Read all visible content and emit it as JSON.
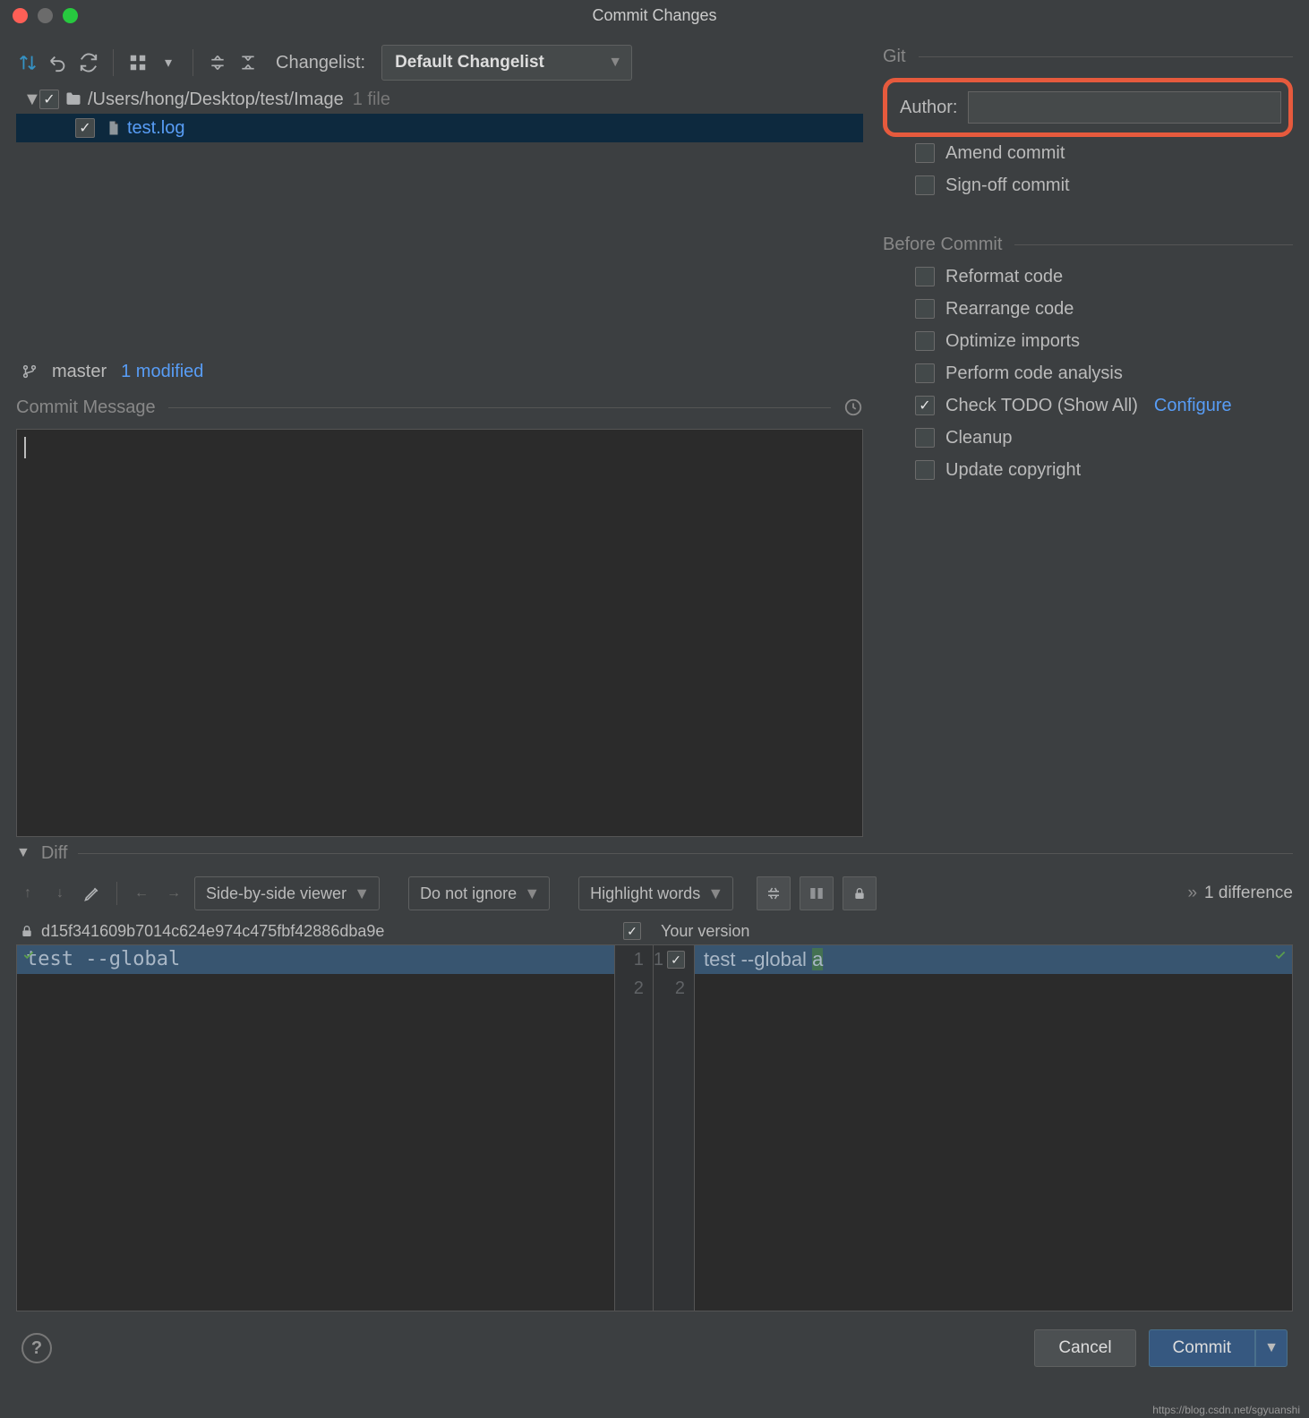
{
  "window": {
    "title": "Commit Changes"
  },
  "toolbar": {
    "changelist_label": "Changelist:",
    "changelist_value": "Default Changelist"
  },
  "tree": {
    "root": {
      "path": "/Users/hong/Desktop/test/Image",
      "count": "1 file"
    },
    "file": {
      "name": "test.log"
    }
  },
  "branch": {
    "name": "master",
    "status": "1 modified"
  },
  "commit_msg": {
    "label": "Commit Message"
  },
  "git": {
    "section": "Git",
    "author_label": "Author:",
    "author_value": "",
    "amend": "Amend commit",
    "signoff": "Sign-off commit"
  },
  "before": {
    "section": "Before Commit",
    "reformat": "Reformat code",
    "rearrange": "Rearrange code",
    "optimize": "Optimize imports",
    "analysis": "Perform code analysis",
    "todo": "Check TODO (Show All)",
    "todo_link": "Configure",
    "cleanup": "Cleanup",
    "copyright": "Update copyright"
  },
  "diff": {
    "label": "Diff",
    "viewer": "Side-by-side viewer",
    "ignore": "Do not ignore",
    "highlight": "Highlight words",
    "count": "1 difference",
    "sha": "d15f341609b7014c624e974c475fbf42886dba9e",
    "your_version": "Your version",
    "left_line1": "test --global",
    "right_line1_pre": "test --global ",
    "right_line1_ins": "a",
    "line_numbers": {
      "l1": "1",
      "l2": "2",
      "r1": "1",
      "r2": "2"
    }
  },
  "footer": {
    "cancel": "Cancel",
    "commit": "Commit"
  },
  "watermark": "https://blog.csdn.net/sgyuanshi"
}
